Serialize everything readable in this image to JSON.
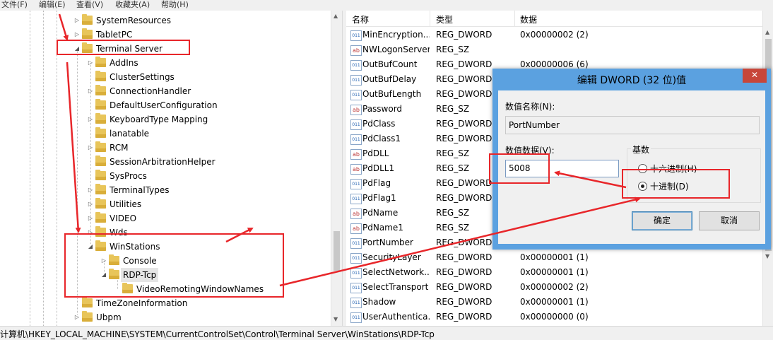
{
  "menubar": {
    "items": [
      "文件(F)",
      "编辑(E)",
      "查看(V)",
      "收藏夹(A)",
      "帮助(H)"
    ]
  },
  "tree": {
    "nodes": [
      {
        "label": "SystemResources"
      },
      {
        "label": "TabletPC"
      },
      {
        "label": "Terminal Server"
      },
      {
        "label": "AddIns"
      },
      {
        "label": "ClusterSettings"
      },
      {
        "label": "ConnectionHandler"
      },
      {
        "label": "DefaultUserConfiguration"
      },
      {
        "label": "KeyboardType Mapping"
      },
      {
        "label": "lanatable"
      },
      {
        "label": "RCM"
      },
      {
        "label": "SessionArbitrationHelper"
      },
      {
        "label": "SysProcs"
      },
      {
        "label": "TerminalTypes"
      },
      {
        "label": "Utilities"
      },
      {
        "label": "VIDEO"
      },
      {
        "label": "Wds"
      },
      {
        "label": "WinStations"
      },
      {
        "label": "Console"
      },
      {
        "label": "RDP-Tcp"
      },
      {
        "label": "VideoRemotingWindowNames"
      },
      {
        "label": "TimeZoneInformation"
      },
      {
        "label": "Ubpm"
      }
    ]
  },
  "list": {
    "headers": {
      "name": "名称",
      "type": "类型",
      "data": "数据"
    },
    "rows": [
      {
        "name": "MinEncryption...",
        "type": "REG_DWORD",
        "data": "0x00000002 (2)",
        "icon": "dword-value-icon"
      },
      {
        "name": "NWLogonServer",
        "type": "REG_SZ",
        "data": "",
        "icon": "string-value-icon"
      },
      {
        "name": "OutBufCount",
        "type": "REG_DWORD",
        "data": "0x00000006 (6)",
        "icon": "dword-value-icon"
      },
      {
        "name": "OutBufDelay",
        "type": "REG_DWORD",
        "data": "",
        "icon": "dword-value-icon"
      },
      {
        "name": "OutBufLength",
        "type": "REG_DWORD",
        "data": "",
        "icon": "dword-value-icon"
      },
      {
        "name": "Password",
        "type": "REG_SZ",
        "data": "",
        "icon": "string-value-icon"
      },
      {
        "name": "PdClass",
        "type": "REG_DWORD",
        "data": "",
        "icon": "dword-value-icon"
      },
      {
        "name": "PdClass1",
        "type": "REG_DWORD",
        "data": "",
        "icon": "dword-value-icon"
      },
      {
        "name": "PdDLL",
        "type": "REG_SZ",
        "data": "",
        "icon": "string-value-icon"
      },
      {
        "name": "PdDLL1",
        "type": "REG_SZ",
        "data": "",
        "icon": "string-value-icon"
      },
      {
        "name": "PdFlag",
        "type": "REG_DWORD",
        "data": "",
        "icon": "dword-value-icon"
      },
      {
        "name": "PdFlag1",
        "type": "REG_DWORD",
        "data": "",
        "icon": "dword-value-icon"
      },
      {
        "name": "PdName",
        "type": "REG_SZ",
        "data": "",
        "icon": "string-value-icon"
      },
      {
        "name": "PdName1",
        "type": "REG_SZ",
        "data": "",
        "icon": "string-value-icon"
      },
      {
        "name": "PortNumber",
        "type": "REG_DWORD",
        "data": "",
        "icon": "dword-value-icon"
      },
      {
        "name": "SecurityLayer",
        "type": "REG_DWORD",
        "data": "0x00000001 (1)",
        "icon": "dword-value-icon"
      },
      {
        "name": "SelectNetwork...",
        "type": "REG_DWORD",
        "data": "0x00000001 (1)",
        "icon": "dword-value-icon"
      },
      {
        "name": "SelectTransport",
        "type": "REG_DWORD",
        "data": "0x00000002 (2)",
        "icon": "dword-value-icon"
      },
      {
        "name": "Shadow",
        "type": "REG_DWORD",
        "data": "0x00000001 (1)",
        "icon": "dword-value-icon"
      },
      {
        "name": "UserAuthentica...",
        "type": "REG_DWORD",
        "data": "0x00000000 (0)",
        "icon": "dword-value-icon"
      }
    ]
  },
  "status": {
    "path": "计算机\\HKEY_LOCAL_MACHINE\\SYSTEM\\CurrentControlSet\\Control\\Terminal Server\\WinStations\\RDP-Tcp"
  },
  "dialog": {
    "title": "编辑 DWORD (32 位)值",
    "close_label": "✕",
    "value_name_label": "数值名称(N):",
    "value_name": "PortNumber",
    "value_data_label": "数值数据(V):",
    "value_data": "5008",
    "base_label": "基数",
    "radio_hex": "十六进制(H)",
    "radio_dec": "十进制(D)",
    "selected_base": "decimal",
    "ok_label": "确定",
    "cancel_label": "取消"
  },
  "annotation_color": "#e8262a"
}
